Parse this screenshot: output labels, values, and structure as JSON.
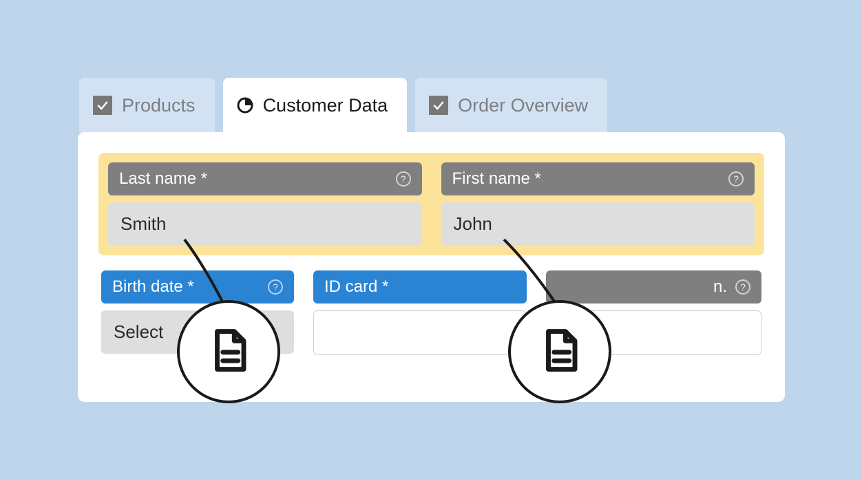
{
  "tabs": {
    "products": "Products",
    "customer_data": "Customer Data",
    "order_overview": "Order Overview"
  },
  "fields": {
    "last_name": {
      "label": "Last name *",
      "value": "Smith"
    },
    "first_name": {
      "label": "First name *",
      "value": "John"
    },
    "birth_date": {
      "label": "Birth date *",
      "value": "Select"
    },
    "id_card": {
      "label": "ID card *",
      "value": ""
    },
    "third_col": {
      "label_fragment": "n.",
      "value": ""
    }
  },
  "help_glyph": "?",
  "icons": {
    "check": "check-icon",
    "pie": "quarter-pie-icon",
    "document": "document-icon"
  }
}
